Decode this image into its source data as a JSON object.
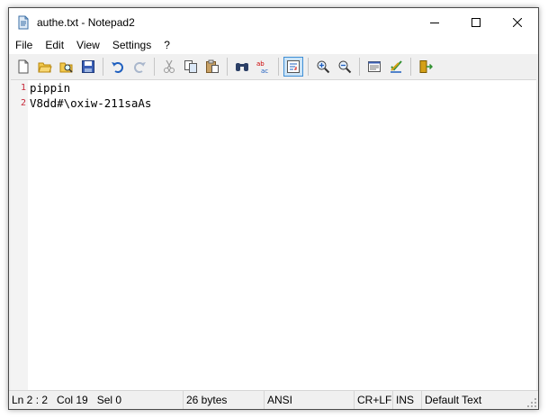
{
  "window": {
    "title": "authe.txt - Notepad2"
  },
  "menu": [
    "File",
    "Edit",
    "View",
    "Settings",
    "?"
  ],
  "toolbar": {
    "buttons": [
      {
        "name": "new-icon"
      },
      {
        "name": "open-icon"
      },
      {
        "name": "browse-icon"
      },
      {
        "name": "save-icon"
      },
      {
        "name": "undo-icon"
      },
      {
        "name": "redo-icon"
      },
      {
        "name": "cut-icon"
      },
      {
        "name": "copy-icon"
      },
      {
        "name": "paste-icon"
      },
      {
        "name": "find-icon"
      },
      {
        "name": "replace-icon"
      },
      {
        "name": "word-wrap-icon"
      },
      {
        "name": "zoom-in-icon"
      },
      {
        "name": "zoom-out-icon"
      },
      {
        "name": "scheme-icon"
      },
      {
        "name": "customize-icon"
      },
      {
        "name": "exit-icon"
      }
    ],
    "active": "word-wrap-icon"
  },
  "editor": {
    "lines": [
      {
        "num": "1",
        "text": "pippin"
      },
      {
        "num": "2",
        "text": "V8dd#\\oxiw-211saAs"
      }
    ]
  },
  "status": {
    "position": "Ln 2 : 2   Col 19   Sel 0",
    "size": "26 bytes",
    "encoding": "ANSI",
    "eol": "CR+LF",
    "mode": "INS",
    "scheme": "Default Text"
  },
  "colors": {
    "line_number": "#c8283a",
    "active_button_bg": "#cce4f7",
    "active_button_border": "#3f8fd6"
  }
}
